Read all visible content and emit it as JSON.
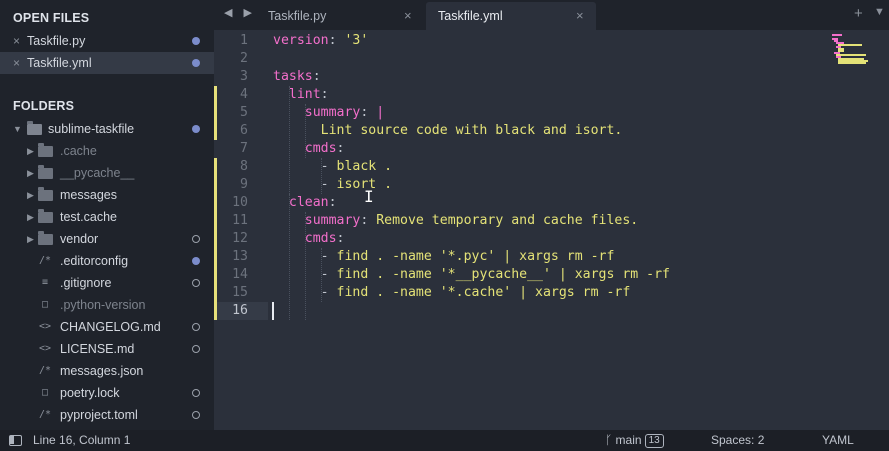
{
  "sidebar": {
    "open_files_title": "OPEN FILES",
    "open_files": [
      {
        "label": "Taskfile.py",
        "close_glyph": "×"
      },
      {
        "label": "Taskfile.yml",
        "close_glyph": "×"
      }
    ],
    "folders_title": "FOLDERS",
    "root_folder": "sublime-taskfile",
    "items": [
      {
        "label": ".cache",
        "kind": "folder"
      },
      {
        "label": "__pycache__",
        "kind": "folder"
      },
      {
        "label": "messages",
        "kind": "folder"
      },
      {
        "label": "test.cache",
        "kind": "folder"
      },
      {
        "label": "vendor",
        "kind": "folder"
      },
      {
        "label": ".editorconfig",
        "kind": "file",
        "icon": "/*"
      },
      {
        "label": ".gitignore",
        "kind": "file",
        "icon": "≡"
      },
      {
        "label": ".python-version",
        "kind": "file",
        "icon": "□"
      },
      {
        "label": "CHANGELOG.md",
        "kind": "file",
        "icon": "<>"
      },
      {
        "label": "LICENSE.md",
        "kind": "file",
        "icon": "<>"
      },
      {
        "label": "messages.json",
        "kind": "file",
        "icon": "/*"
      },
      {
        "label": "poetry.lock",
        "kind": "file",
        "icon": "□"
      },
      {
        "label": "pyproject.toml",
        "kind": "file",
        "icon": "/*"
      }
    ]
  },
  "tabs": {
    "nav_glyph": "◀ ▶",
    "items": [
      {
        "label": "Taskfile.py",
        "close_glyph": "×"
      },
      {
        "label": "Taskfile.yml",
        "close_glyph": "×"
      }
    ],
    "new_tab_glyph": "+",
    "menu_glyph": "▼"
  },
  "editor": {
    "line_numbers": [
      "1",
      "2",
      "3",
      "4",
      "5",
      "6",
      "7",
      "8",
      "9",
      "10",
      "11",
      "12",
      "13",
      "14",
      "15",
      "16"
    ],
    "current_line": "16",
    "lines": [
      [
        {
          "t": "version",
          "c": "k"
        },
        {
          "t": ": ",
          "c": "p"
        },
        {
          "t": "'3'",
          "c": "s"
        }
      ],
      [],
      [
        {
          "t": "tasks",
          "c": "k"
        },
        {
          "t": ":",
          "c": "p"
        }
      ],
      [
        {
          "t": "  "
        },
        {
          "t": "lint",
          "c": "k"
        },
        {
          "t": ":",
          "c": "p"
        }
      ],
      [
        {
          "t": "    "
        },
        {
          "t": "summary",
          "c": "k"
        },
        {
          "t": ": ",
          "c": "p"
        },
        {
          "t": "|",
          "c": "k"
        }
      ],
      [
        {
          "t": "      "
        },
        {
          "t": "Lint source code with black and isort.",
          "c": "s"
        }
      ],
      [
        {
          "t": "    "
        },
        {
          "t": "cmds",
          "c": "k"
        },
        {
          "t": ":",
          "c": "p"
        }
      ],
      [
        {
          "t": "      "
        },
        {
          "t": "- ",
          "c": "p"
        },
        {
          "t": "black .",
          "c": "s"
        }
      ],
      [
        {
          "t": "      "
        },
        {
          "t": "- ",
          "c": "p"
        },
        {
          "t": "isort .",
          "c": "s"
        }
      ],
      [
        {
          "t": "  "
        },
        {
          "t": "clean",
          "c": "k"
        },
        {
          "t": ":",
          "c": "p"
        }
      ],
      [
        {
          "t": "    "
        },
        {
          "t": "summary",
          "c": "k"
        },
        {
          "t": ": ",
          "c": "p"
        },
        {
          "t": "Remove temporary and cache files.",
          "c": "s"
        }
      ],
      [
        {
          "t": "    "
        },
        {
          "t": "cmds",
          "c": "k"
        },
        {
          "t": ":",
          "c": "p"
        }
      ],
      [
        {
          "t": "      "
        },
        {
          "t": "- ",
          "c": "p"
        },
        {
          "t": "find . -name '*.pyc' | xargs rm -rf",
          "c": "s"
        }
      ],
      [
        {
          "t": "      "
        },
        {
          "t": "- ",
          "c": "p"
        },
        {
          "t": "find . -name '*__pycache__' | xargs rm -rf",
          "c": "s"
        }
      ],
      [
        {
          "t": "      "
        },
        {
          "t": "- ",
          "c": "p"
        },
        {
          "t": "find . -name '*.cache' | xargs rm -rf",
          "c": "s"
        }
      ],
      []
    ]
  },
  "statusbar": {
    "position": "Line 16, Column 1",
    "branch": "main",
    "branch_count": "13",
    "indentation": "Spaces: 2",
    "syntax": "YAML"
  },
  "colors": {
    "key": "#f36fcb",
    "string": "#e4e277",
    "sidebar_bg": "#1f232b",
    "editor_bg": "#2b303b",
    "modified_dot": "#7b8ccb",
    "gutter_modified": "#e6e07a"
  }
}
